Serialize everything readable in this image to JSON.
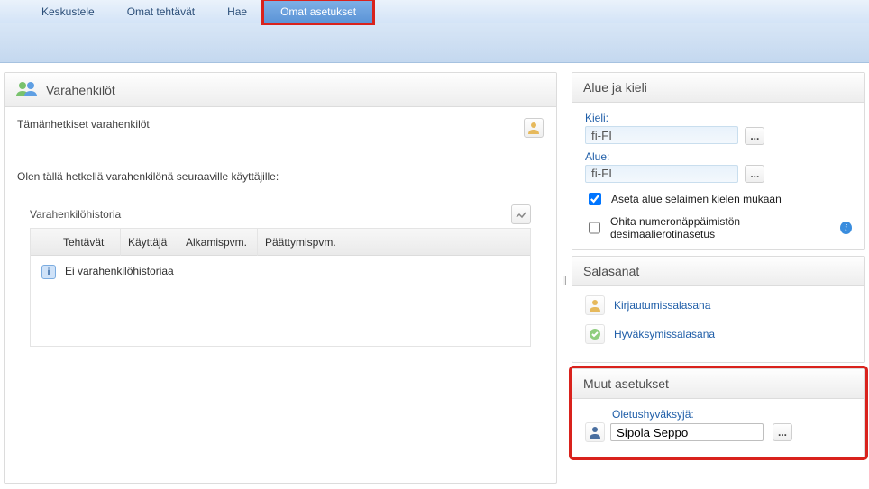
{
  "nav": {
    "items": [
      "Keskustele",
      "Omat tehtävät",
      "Hae",
      "Omat asetukset"
    ],
    "active_index": 3
  },
  "substitutes": {
    "title": "Varahenkilöt",
    "current_label": "Tämänhetkiset varahenkilöt",
    "acting_label": "Olen tällä hetkellä varahenkilönä seuraaville käyttäjille:",
    "history_label": "Varahenkilöhistoria",
    "table": {
      "headers": [
        "Tehtävät",
        "Käyttäjä",
        "Alkamispvm.",
        "Päättymispvm."
      ],
      "empty_msg": "Ei varahenkilöhistoriaa"
    }
  },
  "locale": {
    "title": "Alue ja kieli",
    "lang_label": "Kieli:",
    "lang_value": "fi-FI",
    "region_label": "Alue:",
    "region_value": "fi-FI",
    "cb_browser": "Aseta alue selaimen kielen mukaan",
    "cb_browser_checked": true,
    "cb_numpad": "Ohita numeronäppäimistön desimaalierotinasetus",
    "cb_numpad_checked": false
  },
  "passwords": {
    "title": "Salasanat",
    "login": "Kirjautumissalasana",
    "approve": "Hyväksymissalasana"
  },
  "other": {
    "title": "Muut asetukset",
    "approver_label": "Oletushyväksyjä:",
    "approver_value": "Sipola Seppo"
  }
}
